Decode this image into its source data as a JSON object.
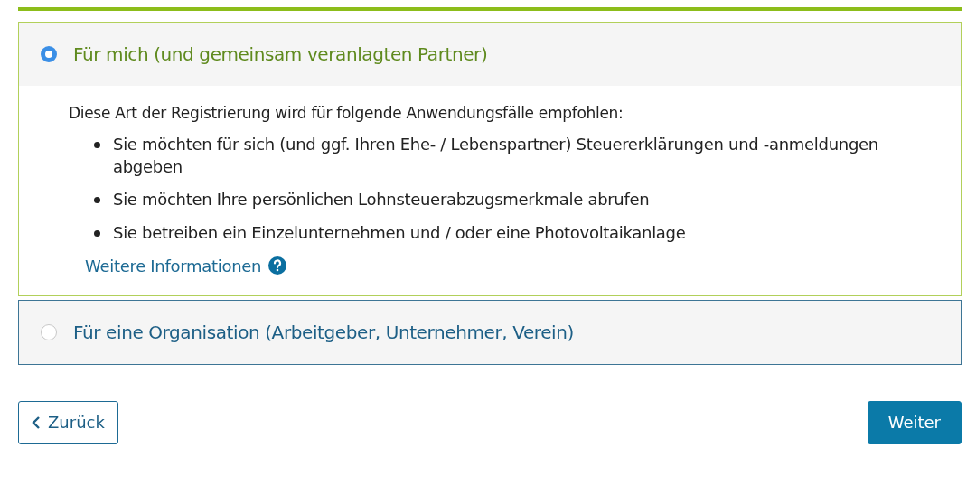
{
  "options": [
    {
      "label": "Für mich (und gemeinsam veranlagten Partner)",
      "selected": true,
      "intro": "Diese Art der Registrierung wird für folgende Anwendungsfälle empfohlen:",
      "bullets": [
        "Sie möchten für sich (und ggf. Ihren Ehe- / Lebenspartner) Steuererklärungen und -anmeldungen abgeben",
        "Sie möchten Ihre persönlichen Lohnsteuerabzugsmerkmale abrufen",
        "Sie betreiben ein Einzelunternehmen und / oder eine Photovoltaikanlage"
      ],
      "link": "Weitere Informationen"
    },
    {
      "label": "Für eine Organisation (Arbeitgeber, Unternehmer, Verein)",
      "selected": false
    }
  ],
  "buttons": [
    {
      "kind": "back",
      "label": "Zurück"
    },
    {
      "kind": "next",
      "label": "Weiter"
    }
  ]
}
